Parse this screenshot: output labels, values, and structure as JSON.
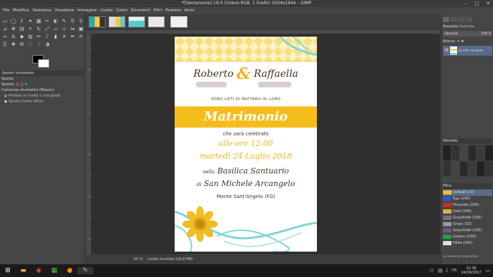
{
  "window": {
    "title": "*[Senzanome]-19.0 (Colore RGB, 1 livello) 1054x1644 – GIMP",
    "minimize": "–",
    "maximize": "□",
    "close": "✕"
  },
  "menu": [
    "File",
    "Modifica",
    "Seleziona",
    "Visualizza",
    "Immagine",
    "Livello",
    "Colori",
    "Strumenti",
    "Filtri",
    "Finestre",
    "Aiuto"
  ],
  "tool_options": {
    "header": "Opzioni strumento",
    "tool_name": "Sposta",
    "move_label": "Sposta:",
    "toggle_label": "Commuta strumento (Maiusc)",
    "radio1": "Preleva un livello o una guida",
    "radio2": "Sposta livello attivo"
  },
  "status": {
    "zoom": "50 %",
    "layer_info": "Livello incollato (18,8 MB)"
  },
  "right_panel": {
    "mode_label": "Modalità",
    "mode_value": "Normale",
    "opacity_label": "Opacità",
    "opacity_value": "100.0",
    "lock_label": "Blocco:",
    "layer_name": "Livello incollato",
    "brush_header": "Pennello",
    "gradient_header": "Filtro",
    "gradient_footer": "incrementa marcatore",
    "gradients": [
      {
        "name": "Default (23)",
        "color": "#f0c030"
      },
      {
        "name": "Ega (240)",
        "color": "#2060c0"
      },
      {
        "name": "Fireyside (256)",
        "color": "#c03020"
      },
      {
        "name": "Gold (256)",
        "color": "#e0b030"
      },
      {
        "name": "GrayViolet (256)",
        "color": "#7a6a8a"
      },
      {
        "name": "Grays (32)",
        "color": "#999999"
      },
      {
        "name": "GrayViolet (256)",
        "color": "#6a5a7a"
      },
      {
        "name": "Greens (256)",
        "color": "#20a040"
      },
      {
        "name": "Hilite (256)",
        "color": "#e0e0e0"
      }
    ]
  },
  "invitation": {
    "name1": "Roberto",
    "amp": "&",
    "name2": "Raffaella",
    "subtitle": "SONO LIETI DI INVITARVI AL LORO",
    "title": "Matrimonio",
    "line1": "che sarà celebrato",
    "line2": "alle ore 12.00",
    "line3": "martedì 24 Luglio 2018",
    "line4_prefix": "nella",
    "line4": "Basilica Santuario",
    "line5_prefix": "di",
    "line5": "San Michele Arcangelo",
    "line6": "Monte Sant'Angelo (FG)"
  },
  "taskbar": {
    "language": "ITA",
    "time": "22:38",
    "date": "24/09/2017"
  },
  "colors": {
    "accent_yellow": "#f5bd1c",
    "text_brown": "#4a3322",
    "ribbon_teal": "#7fd6d6",
    "taskbar": "#1a1a1a"
  }
}
